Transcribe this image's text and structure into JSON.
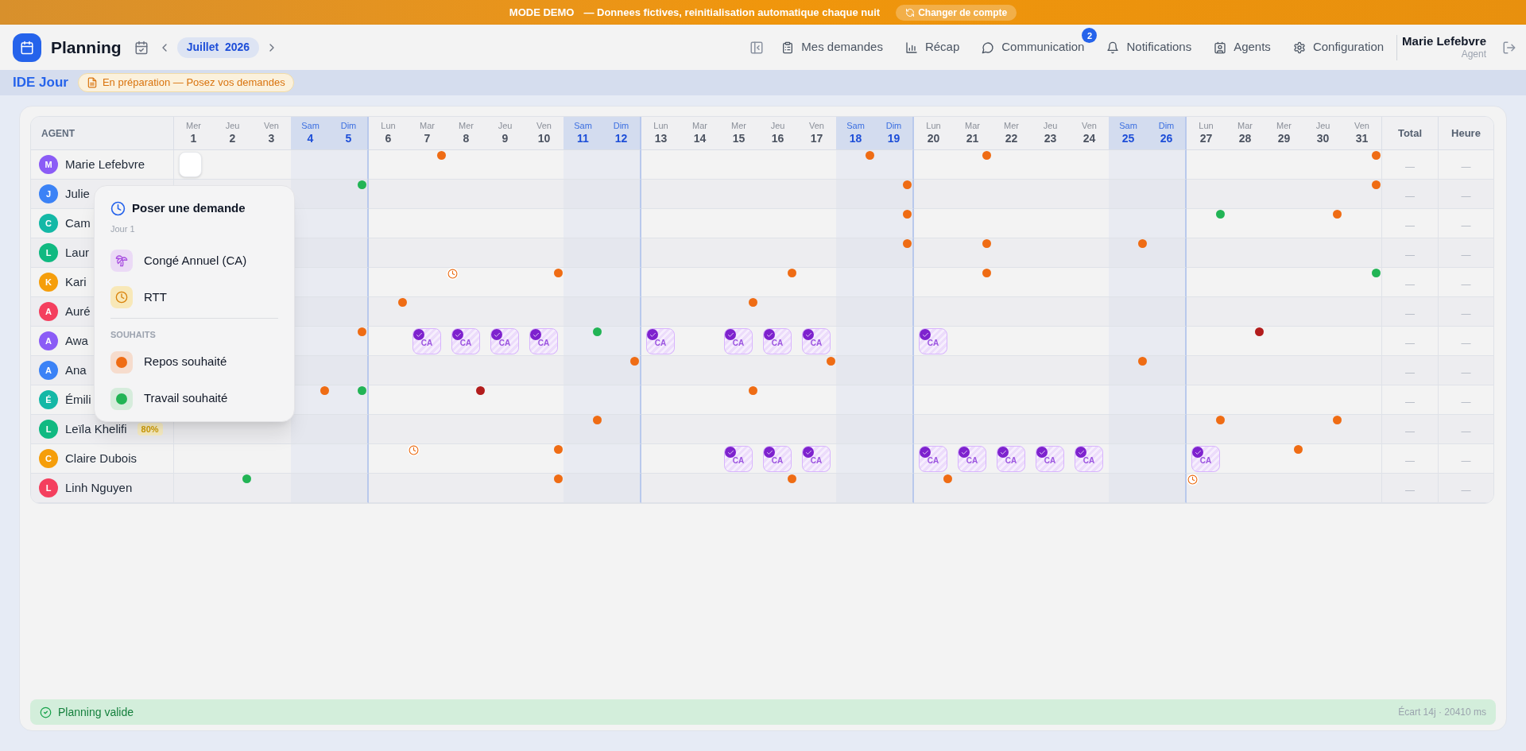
{
  "demo_banner": {
    "mode": "MODE DEMO",
    "message": "— Donnees fictives, reinitialisation automatique chaque nuit",
    "button": "Changer de compte"
  },
  "header": {
    "title": "Planning",
    "month": "Juillet  2026",
    "nav": [
      {
        "label": "Mes demandes"
      },
      {
        "label": "Récap"
      },
      {
        "label": "Communication",
        "badge": "2"
      },
      {
        "label": "Notifications"
      },
      {
        "label": "Agents"
      },
      {
        "label": "Configuration"
      }
    ],
    "user": {
      "name": "Marie Lefebvre",
      "role": "Agent"
    }
  },
  "subheader": {
    "team": "IDE Jour",
    "status": "En préparation — Posez vos demandes"
  },
  "table": {
    "agent_heading": "AGENT",
    "total_heading": "Total",
    "hours_heading": "Heure",
    "days": [
      {
        "weekday": "Mer",
        "day": "1",
        "weekend": false
      },
      {
        "weekday": "Jeu",
        "day": "2",
        "weekend": false
      },
      {
        "weekday": "Ven",
        "day": "3",
        "weekend": false
      },
      {
        "weekday": "Sam",
        "day": "4",
        "weekend": true
      },
      {
        "weekday": "Dim",
        "day": "5",
        "weekend": true
      },
      {
        "weekday": "Lun",
        "day": "6",
        "weekend": false
      },
      {
        "weekday": "Mar",
        "day": "7",
        "weekend": false
      },
      {
        "weekday": "Mer",
        "day": "8",
        "weekend": false
      },
      {
        "weekday": "Jeu",
        "day": "9",
        "weekend": false
      },
      {
        "weekday": "Ven",
        "day": "10",
        "weekend": false
      },
      {
        "weekday": "Sam",
        "day": "11",
        "weekend": true
      },
      {
        "weekday": "Dim",
        "day": "12",
        "weekend": true
      },
      {
        "weekday": "Lun",
        "day": "13",
        "weekend": false
      },
      {
        "weekday": "Mar",
        "day": "14",
        "weekend": false
      },
      {
        "weekday": "Mer",
        "day": "15",
        "weekend": false
      },
      {
        "weekday": "Jeu",
        "day": "16",
        "weekend": false
      },
      {
        "weekday": "Ven",
        "day": "17",
        "weekend": false
      },
      {
        "weekday": "Sam",
        "day": "18",
        "weekend": true
      },
      {
        "weekday": "Dim",
        "day": "19",
        "weekend": true
      },
      {
        "weekday": "Lun",
        "day": "20",
        "weekend": false
      },
      {
        "weekday": "Mar",
        "day": "21",
        "weekend": false
      },
      {
        "weekday": "Mer",
        "day": "22",
        "weekend": false
      },
      {
        "weekday": "Jeu",
        "day": "23",
        "weekend": false
      },
      {
        "weekday": "Ven",
        "day": "24",
        "weekend": false
      },
      {
        "weekday": "Sam",
        "day": "25",
        "weekend": true
      },
      {
        "weekday": "Dim",
        "day": "26",
        "weekend": true
      },
      {
        "weekday": "Lun",
        "day": "27",
        "weekend": false
      },
      {
        "weekday": "Mar",
        "day": "28",
        "weekend": false
      },
      {
        "weekday": "Mer",
        "day": "29",
        "weekend": false
      },
      {
        "weekday": "Jeu",
        "day": "30",
        "weekend": false
      },
      {
        "weekday": "Ven",
        "day": "31",
        "weekend": false
      }
    ],
    "rows": [
      {
        "initial": "M",
        "name": "Marie Lefebvre",
        "color": "#8b5cf6",
        "total": "—",
        "hours": "—",
        "cells": [
          {
            "kind": "selected"
          },
          {
            "kind": "none"
          },
          {
            "kind": "none"
          },
          {
            "kind": "none"
          },
          {
            "kind": "none"
          },
          {
            "kind": "none"
          },
          {
            "kind": "rest"
          },
          {
            "kind": "none"
          },
          {
            "kind": "none"
          },
          {
            "kind": "none"
          },
          {
            "kind": "none"
          },
          {
            "kind": "none"
          },
          {
            "kind": "none"
          },
          {
            "kind": "none"
          },
          {
            "kind": "none"
          },
          {
            "kind": "none"
          },
          {
            "kind": "none"
          },
          {
            "kind": "rest"
          },
          {
            "kind": "none"
          },
          {
            "kind": "none"
          },
          {
            "kind": "rest"
          },
          {
            "kind": "none"
          },
          {
            "kind": "none"
          },
          {
            "kind": "none"
          },
          {
            "kind": "none"
          },
          {
            "kind": "none"
          },
          {
            "kind": "none"
          },
          {
            "kind": "none"
          },
          {
            "kind": "none"
          },
          {
            "kind": "none"
          },
          {
            "kind": "rest"
          }
        ]
      },
      {
        "initial": "J",
        "name": "Julie",
        "color": "#3b82f6",
        "total": "—",
        "hours": "—",
        "cells": [
          {
            "kind": "none"
          },
          {
            "kind": "none"
          },
          {
            "kind": "none"
          },
          {
            "kind": "none"
          },
          {
            "kind": "work"
          },
          {
            "kind": "none"
          },
          {
            "kind": "none"
          },
          {
            "kind": "none"
          },
          {
            "kind": "none"
          },
          {
            "kind": "none"
          },
          {
            "kind": "none"
          },
          {
            "kind": "none"
          },
          {
            "kind": "none"
          },
          {
            "kind": "none"
          },
          {
            "kind": "none"
          },
          {
            "kind": "none"
          },
          {
            "kind": "none"
          },
          {
            "kind": "none"
          },
          {
            "kind": "rest"
          },
          {
            "kind": "none"
          },
          {
            "kind": "none"
          },
          {
            "kind": "none"
          },
          {
            "kind": "none"
          },
          {
            "kind": "none"
          },
          {
            "kind": "none"
          },
          {
            "kind": "none"
          },
          {
            "kind": "none"
          },
          {
            "kind": "none"
          },
          {
            "kind": "none"
          },
          {
            "kind": "none"
          },
          {
            "kind": "rest"
          }
        ]
      },
      {
        "initial": "C",
        "name": "Cam",
        "color": "#14b8a6",
        "total": "—",
        "hours": "—",
        "cells": [
          {
            "kind": "none"
          },
          {
            "kind": "none"
          },
          {
            "kind": "none"
          },
          {
            "kind": "none"
          },
          {
            "kind": "none"
          },
          {
            "kind": "none"
          },
          {
            "kind": "none"
          },
          {
            "kind": "none"
          },
          {
            "kind": "none"
          },
          {
            "kind": "none"
          },
          {
            "kind": "none"
          },
          {
            "kind": "none"
          },
          {
            "kind": "none"
          },
          {
            "kind": "none"
          },
          {
            "kind": "none"
          },
          {
            "kind": "none"
          },
          {
            "kind": "none"
          },
          {
            "kind": "none"
          },
          {
            "kind": "rest"
          },
          {
            "kind": "none"
          },
          {
            "kind": "none"
          },
          {
            "kind": "none"
          },
          {
            "kind": "none"
          },
          {
            "kind": "none"
          },
          {
            "kind": "none"
          },
          {
            "kind": "none"
          },
          {
            "kind": "work"
          },
          {
            "kind": "none"
          },
          {
            "kind": "none"
          },
          {
            "kind": "rest"
          },
          {
            "kind": "none"
          }
        ]
      },
      {
        "initial": "L",
        "name": "Laur",
        "color": "#10b981",
        "total": "—",
        "hours": "—",
        "cells": [
          {
            "kind": "none"
          },
          {
            "kind": "none"
          },
          {
            "kind": "none"
          },
          {
            "kind": "none"
          },
          {
            "kind": "none"
          },
          {
            "kind": "none"
          },
          {
            "kind": "none"
          },
          {
            "kind": "none"
          },
          {
            "kind": "none"
          },
          {
            "kind": "none"
          },
          {
            "kind": "none"
          },
          {
            "kind": "none"
          },
          {
            "kind": "none"
          },
          {
            "kind": "none"
          },
          {
            "kind": "none"
          },
          {
            "kind": "none"
          },
          {
            "kind": "none"
          },
          {
            "kind": "none"
          },
          {
            "kind": "rest"
          },
          {
            "kind": "none"
          },
          {
            "kind": "rest"
          },
          {
            "kind": "none"
          },
          {
            "kind": "none"
          },
          {
            "kind": "none"
          },
          {
            "kind": "rest"
          },
          {
            "kind": "none"
          },
          {
            "kind": "none"
          },
          {
            "kind": "none"
          },
          {
            "kind": "none"
          },
          {
            "kind": "none"
          },
          {
            "kind": "none"
          }
        ]
      },
      {
        "initial": "K",
        "name": "Kari",
        "color": "#f59e0b",
        "total": "—",
        "hours": "—",
        "cells": [
          {
            "kind": "none"
          },
          {
            "kind": "none"
          },
          {
            "kind": "none"
          },
          {
            "kind": "none"
          },
          {
            "kind": "none"
          },
          {
            "kind": "none"
          },
          {
            "kind": "none"
          },
          {
            "kind": "rtt"
          },
          {
            "kind": "none"
          },
          {
            "kind": "rest"
          },
          {
            "kind": "none"
          },
          {
            "kind": "none"
          },
          {
            "kind": "none"
          },
          {
            "kind": "none"
          },
          {
            "kind": "none"
          },
          {
            "kind": "rest"
          },
          {
            "kind": "none"
          },
          {
            "kind": "none"
          },
          {
            "kind": "none"
          },
          {
            "kind": "none"
          },
          {
            "kind": "rest"
          },
          {
            "kind": "none"
          },
          {
            "kind": "none"
          },
          {
            "kind": "none"
          },
          {
            "kind": "none"
          },
          {
            "kind": "none"
          },
          {
            "kind": "none"
          },
          {
            "kind": "none"
          },
          {
            "kind": "none"
          },
          {
            "kind": "none"
          },
          {
            "kind": "work"
          }
        ]
      },
      {
        "initial": "A",
        "name": "Auré",
        "color": "#f43f5e",
        "total": "—",
        "hours": "—",
        "cells": [
          {
            "kind": "none"
          },
          {
            "kind": "none"
          },
          {
            "kind": "none"
          },
          {
            "kind": "none"
          },
          {
            "kind": "none"
          },
          {
            "kind": "rest"
          },
          {
            "kind": "none"
          },
          {
            "kind": "none"
          },
          {
            "kind": "none"
          },
          {
            "kind": "none"
          },
          {
            "kind": "none"
          },
          {
            "kind": "none"
          },
          {
            "kind": "none"
          },
          {
            "kind": "none"
          },
          {
            "kind": "rest"
          },
          {
            "kind": "none"
          },
          {
            "kind": "none"
          },
          {
            "kind": "none"
          },
          {
            "kind": "none"
          },
          {
            "kind": "none"
          },
          {
            "kind": "none"
          },
          {
            "kind": "none"
          },
          {
            "kind": "none"
          },
          {
            "kind": "none"
          },
          {
            "kind": "none"
          },
          {
            "kind": "none"
          },
          {
            "kind": "none"
          },
          {
            "kind": "none"
          },
          {
            "kind": "none"
          },
          {
            "kind": "none"
          },
          {
            "kind": "none"
          }
        ]
      },
      {
        "initial": "A",
        "name": "Awa",
        "color": "#8b5cf6",
        "total": "—",
        "hours": "—",
        "cells": [
          {
            "kind": "none"
          },
          {
            "kind": "none"
          },
          {
            "kind": "none"
          },
          {
            "kind": "none"
          },
          {
            "kind": "rest"
          },
          {
            "kind": "none"
          },
          {
            "kind": "ca",
            "label": "CA"
          },
          {
            "kind": "ca",
            "label": "CA"
          },
          {
            "kind": "ca",
            "label": "CA"
          },
          {
            "kind": "ca",
            "label": "CA"
          },
          {
            "kind": "work"
          },
          {
            "kind": "none"
          },
          {
            "kind": "ca",
            "label": "CA"
          },
          {
            "kind": "none"
          },
          {
            "kind": "ca",
            "label": "CA"
          },
          {
            "kind": "ca",
            "label": "CA"
          },
          {
            "kind": "ca",
            "label": "CA"
          },
          {
            "kind": "none"
          },
          {
            "kind": "none"
          },
          {
            "kind": "ca",
            "label": "CA"
          },
          {
            "kind": "none"
          },
          {
            "kind": "none"
          },
          {
            "kind": "none"
          },
          {
            "kind": "none"
          },
          {
            "kind": "none"
          },
          {
            "kind": "none"
          },
          {
            "kind": "none"
          },
          {
            "kind": "conflict"
          },
          {
            "kind": "none"
          },
          {
            "kind": "none"
          },
          {
            "kind": "none"
          }
        ]
      },
      {
        "initial": "A",
        "name": "Ana",
        "color": "#3b82f6",
        "total": "—",
        "hours": "—",
        "cells": [
          {
            "kind": "none"
          },
          {
            "kind": "none"
          },
          {
            "kind": "none"
          },
          {
            "kind": "none"
          },
          {
            "kind": "none"
          },
          {
            "kind": "none"
          },
          {
            "kind": "none"
          },
          {
            "kind": "none"
          },
          {
            "kind": "none"
          },
          {
            "kind": "none"
          },
          {
            "kind": "none"
          },
          {
            "kind": "rest"
          },
          {
            "kind": "none"
          },
          {
            "kind": "none"
          },
          {
            "kind": "none"
          },
          {
            "kind": "none"
          },
          {
            "kind": "rest"
          },
          {
            "kind": "none"
          },
          {
            "kind": "none"
          },
          {
            "kind": "none"
          },
          {
            "kind": "none"
          },
          {
            "kind": "none"
          },
          {
            "kind": "none"
          },
          {
            "kind": "none"
          },
          {
            "kind": "rest"
          },
          {
            "kind": "none"
          },
          {
            "kind": "none"
          },
          {
            "kind": "none"
          },
          {
            "kind": "none"
          },
          {
            "kind": "none"
          },
          {
            "kind": "none"
          }
        ]
      },
      {
        "initial": "É",
        "name": "Émili",
        "color": "#14b8a6",
        "total": "—",
        "hours": "—",
        "cells": [
          {
            "kind": "none"
          },
          {
            "kind": "none"
          },
          {
            "kind": "none"
          },
          {
            "kind": "rest"
          },
          {
            "kind": "work"
          },
          {
            "kind": "none"
          },
          {
            "kind": "none"
          },
          {
            "kind": "conflict"
          },
          {
            "kind": "none"
          },
          {
            "kind": "none"
          },
          {
            "kind": "none"
          },
          {
            "kind": "none"
          },
          {
            "kind": "none"
          },
          {
            "kind": "none"
          },
          {
            "kind": "rest"
          },
          {
            "kind": "none"
          },
          {
            "kind": "none"
          },
          {
            "kind": "none"
          },
          {
            "kind": "none"
          },
          {
            "kind": "none"
          },
          {
            "kind": "none"
          },
          {
            "kind": "none"
          },
          {
            "kind": "none"
          },
          {
            "kind": "none"
          },
          {
            "kind": "none"
          },
          {
            "kind": "none"
          },
          {
            "kind": "none"
          },
          {
            "kind": "none"
          },
          {
            "kind": "none"
          },
          {
            "kind": "none"
          },
          {
            "kind": "none"
          }
        ]
      },
      {
        "initial": "L",
        "name": "Leïla Khelifi",
        "badge": "80%",
        "color": "#10b981",
        "total": "—",
        "hours": "—",
        "cells": [
          {
            "kind": "none"
          },
          {
            "kind": "none"
          },
          {
            "kind": "none"
          },
          {
            "kind": "none"
          },
          {
            "kind": "none"
          },
          {
            "kind": "none"
          },
          {
            "kind": "none"
          },
          {
            "kind": "none"
          },
          {
            "kind": "none"
          },
          {
            "kind": "none"
          },
          {
            "kind": "rest"
          },
          {
            "kind": "none"
          },
          {
            "kind": "none"
          },
          {
            "kind": "none"
          },
          {
            "kind": "none"
          },
          {
            "kind": "none"
          },
          {
            "kind": "none"
          },
          {
            "kind": "none"
          },
          {
            "kind": "none"
          },
          {
            "kind": "none"
          },
          {
            "kind": "none"
          },
          {
            "kind": "none"
          },
          {
            "kind": "none"
          },
          {
            "kind": "none"
          },
          {
            "kind": "none"
          },
          {
            "kind": "none"
          },
          {
            "kind": "rest"
          },
          {
            "kind": "none"
          },
          {
            "kind": "none"
          },
          {
            "kind": "rest"
          },
          {
            "kind": "none"
          }
        ]
      },
      {
        "initial": "C",
        "name": "Claire Dubois",
        "color": "#f59e0b",
        "total": "—",
        "hours": "—",
        "cells": [
          {
            "kind": "none"
          },
          {
            "kind": "none"
          },
          {
            "kind": "none"
          },
          {
            "kind": "none"
          },
          {
            "kind": "none"
          },
          {
            "kind": "none"
          },
          {
            "kind": "rtt"
          },
          {
            "kind": "none"
          },
          {
            "kind": "none"
          },
          {
            "kind": "rest"
          },
          {
            "kind": "none"
          },
          {
            "kind": "none"
          },
          {
            "kind": "none"
          },
          {
            "kind": "none"
          },
          {
            "kind": "ca",
            "label": "CA"
          },
          {
            "kind": "ca",
            "label": "CA"
          },
          {
            "kind": "ca",
            "label": "CA"
          },
          {
            "kind": "none"
          },
          {
            "kind": "none"
          },
          {
            "kind": "ca",
            "label": "CA"
          },
          {
            "kind": "ca",
            "label": "CA"
          },
          {
            "kind": "ca",
            "label": "CA"
          },
          {
            "kind": "ca",
            "label": "CA"
          },
          {
            "kind": "ca",
            "label": "CA"
          },
          {
            "kind": "none"
          },
          {
            "kind": "none"
          },
          {
            "kind": "ca",
            "label": "CA"
          },
          {
            "kind": "none"
          },
          {
            "kind": "rest"
          },
          {
            "kind": "none"
          },
          {
            "kind": "none"
          }
        ]
      },
      {
        "initial": "L",
        "name": "Linh Nguyen",
        "color": "#f43f5e",
        "total": "—",
        "hours": "—",
        "cells": [
          {
            "kind": "none"
          },
          {
            "kind": "work"
          },
          {
            "kind": "none"
          },
          {
            "kind": "none"
          },
          {
            "kind": "none"
          },
          {
            "kind": "none"
          },
          {
            "kind": "none"
          },
          {
            "kind": "none"
          },
          {
            "kind": "none"
          },
          {
            "kind": "rest"
          },
          {
            "kind": "none"
          },
          {
            "kind": "none"
          },
          {
            "kind": "none"
          },
          {
            "kind": "none"
          },
          {
            "kind": "none"
          },
          {
            "kind": "rest"
          },
          {
            "kind": "none"
          },
          {
            "kind": "none"
          },
          {
            "kind": "none"
          },
          {
            "kind": "rest"
          },
          {
            "kind": "none"
          },
          {
            "kind": "none"
          },
          {
            "kind": "none"
          },
          {
            "kind": "none"
          },
          {
            "kind": "none"
          },
          {
            "kind": "none"
          },
          {
            "kind": "rtt"
          },
          {
            "kind": "none"
          },
          {
            "kind": "none"
          },
          {
            "kind": "none"
          },
          {
            "kind": "none"
          }
        ]
      }
    ]
  },
  "popover": {
    "title": "Poser une demande",
    "subtitle": "Jour 1",
    "options": [
      {
        "kind": "ca",
        "label": "Congé Annuel (CA)"
      },
      {
        "kind": "rtt",
        "label": "RTT"
      }
    ],
    "section": "SOUHAITS",
    "wishes": [
      {
        "kind": "rest",
        "label": "Repos souhaité"
      },
      {
        "kind": "work",
        "label": "Travail souhaité"
      }
    ]
  },
  "status_bar": {
    "message": "Planning valide",
    "metrics": "Écart 14j · 20410 ms"
  }
}
